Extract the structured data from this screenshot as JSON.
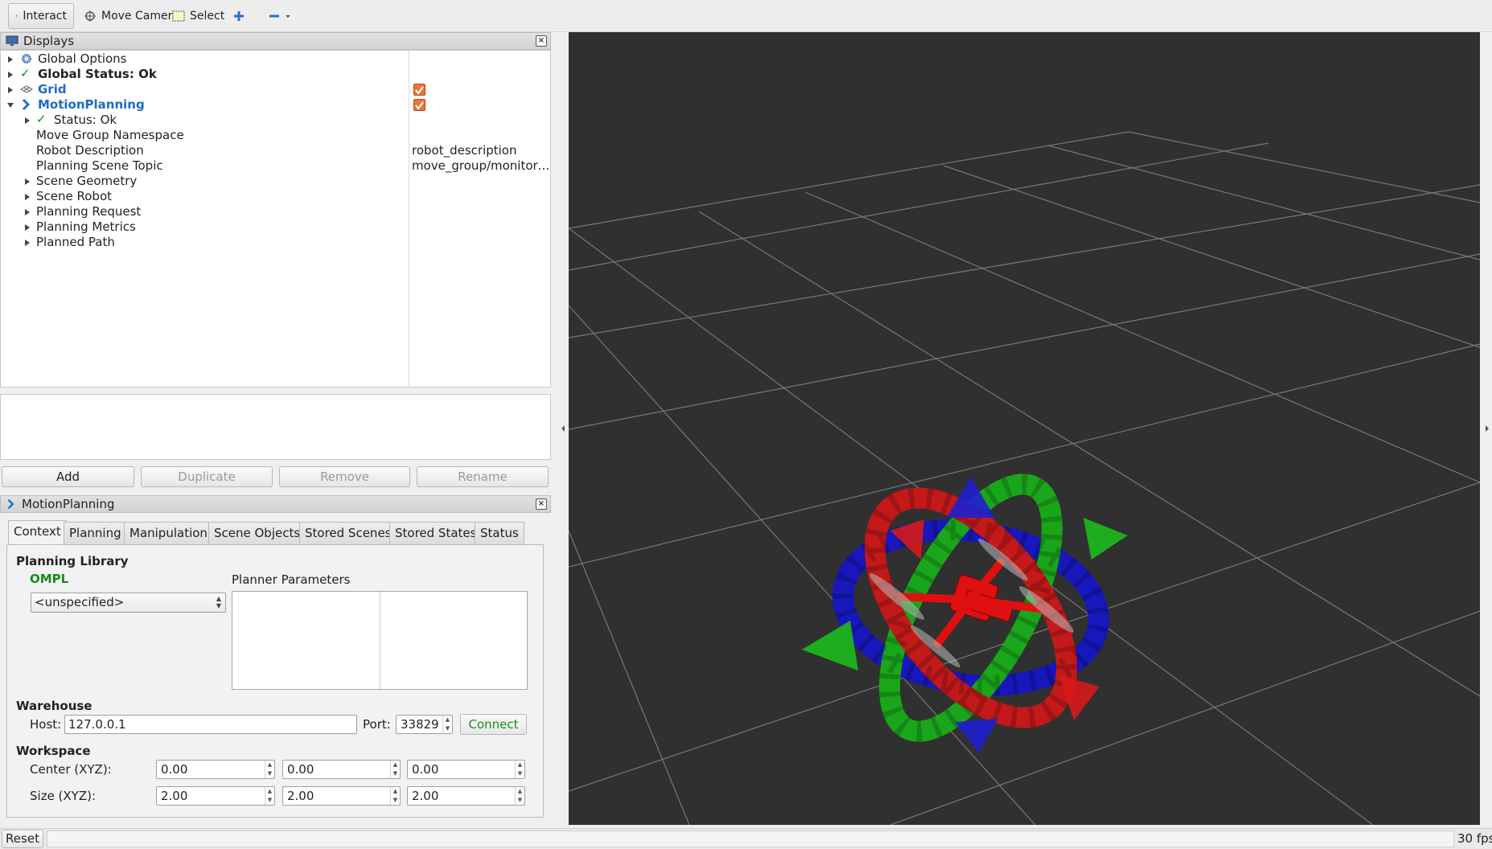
{
  "toolbar": {
    "interact": "Interact",
    "move_camera": "Move Camera",
    "select": "Select"
  },
  "displays": {
    "title": "Displays",
    "items": [
      {
        "label": "Global Options"
      },
      {
        "label": "Global Status: Ok"
      },
      {
        "label": "Grid",
        "checked": true
      },
      {
        "label": "MotionPlanning",
        "checked": true
      },
      {
        "label": "Status: Ok"
      },
      {
        "label": "Move Group Namespace",
        "value": ""
      },
      {
        "label": "Robot Description",
        "value": "robot_description"
      },
      {
        "label": "Planning Scene Topic",
        "value": "move_group/monitore…"
      },
      {
        "label": "Scene Geometry"
      },
      {
        "label": "Scene Robot"
      },
      {
        "label": "Planning Request"
      },
      {
        "label": "Planning Metrics"
      },
      {
        "label": "Planned Path"
      }
    ],
    "buttons": {
      "add": "Add",
      "duplicate": "Duplicate",
      "remove": "Remove",
      "rename": "Rename"
    }
  },
  "motion_planning": {
    "title": "MotionPlanning",
    "tabs": [
      "Context",
      "Planning",
      "Manipulation",
      "Scene Objects",
      "Stored Scenes",
      "Stored States",
      "Status"
    ],
    "active_tab": "Context",
    "planning_library": {
      "heading": "Planning Library",
      "library": "OMPL",
      "planner_select": "<unspecified>",
      "planner_params_label": "Planner Parameters"
    },
    "warehouse": {
      "heading": "Warehouse",
      "host_label": "Host:",
      "host": "127.0.0.1",
      "port_label": "Port:",
      "port": "33829",
      "connect": "Connect"
    },
    "workspace": {
      "heading": "Workspace",
      "center_label": "Center (XYZ):",
      "center": [
        "0.00",
        "0.00",
        "0.00"
      ],
      "size_label": "Size (XYZ):",
      "size": [
        "2.00",
        "2.00",
        "2.00"
      ]
    }
  },
  "statusbar": {
    "reset": "Reset",
    "fps": "30 fps"
  },
  "colors": {
    "link_blue": "#1e6bc4",
    "ok_green": "#1a8a1a",
    "checkbox": "#e9743c",
    "viewport": "#303030"
  }
}
